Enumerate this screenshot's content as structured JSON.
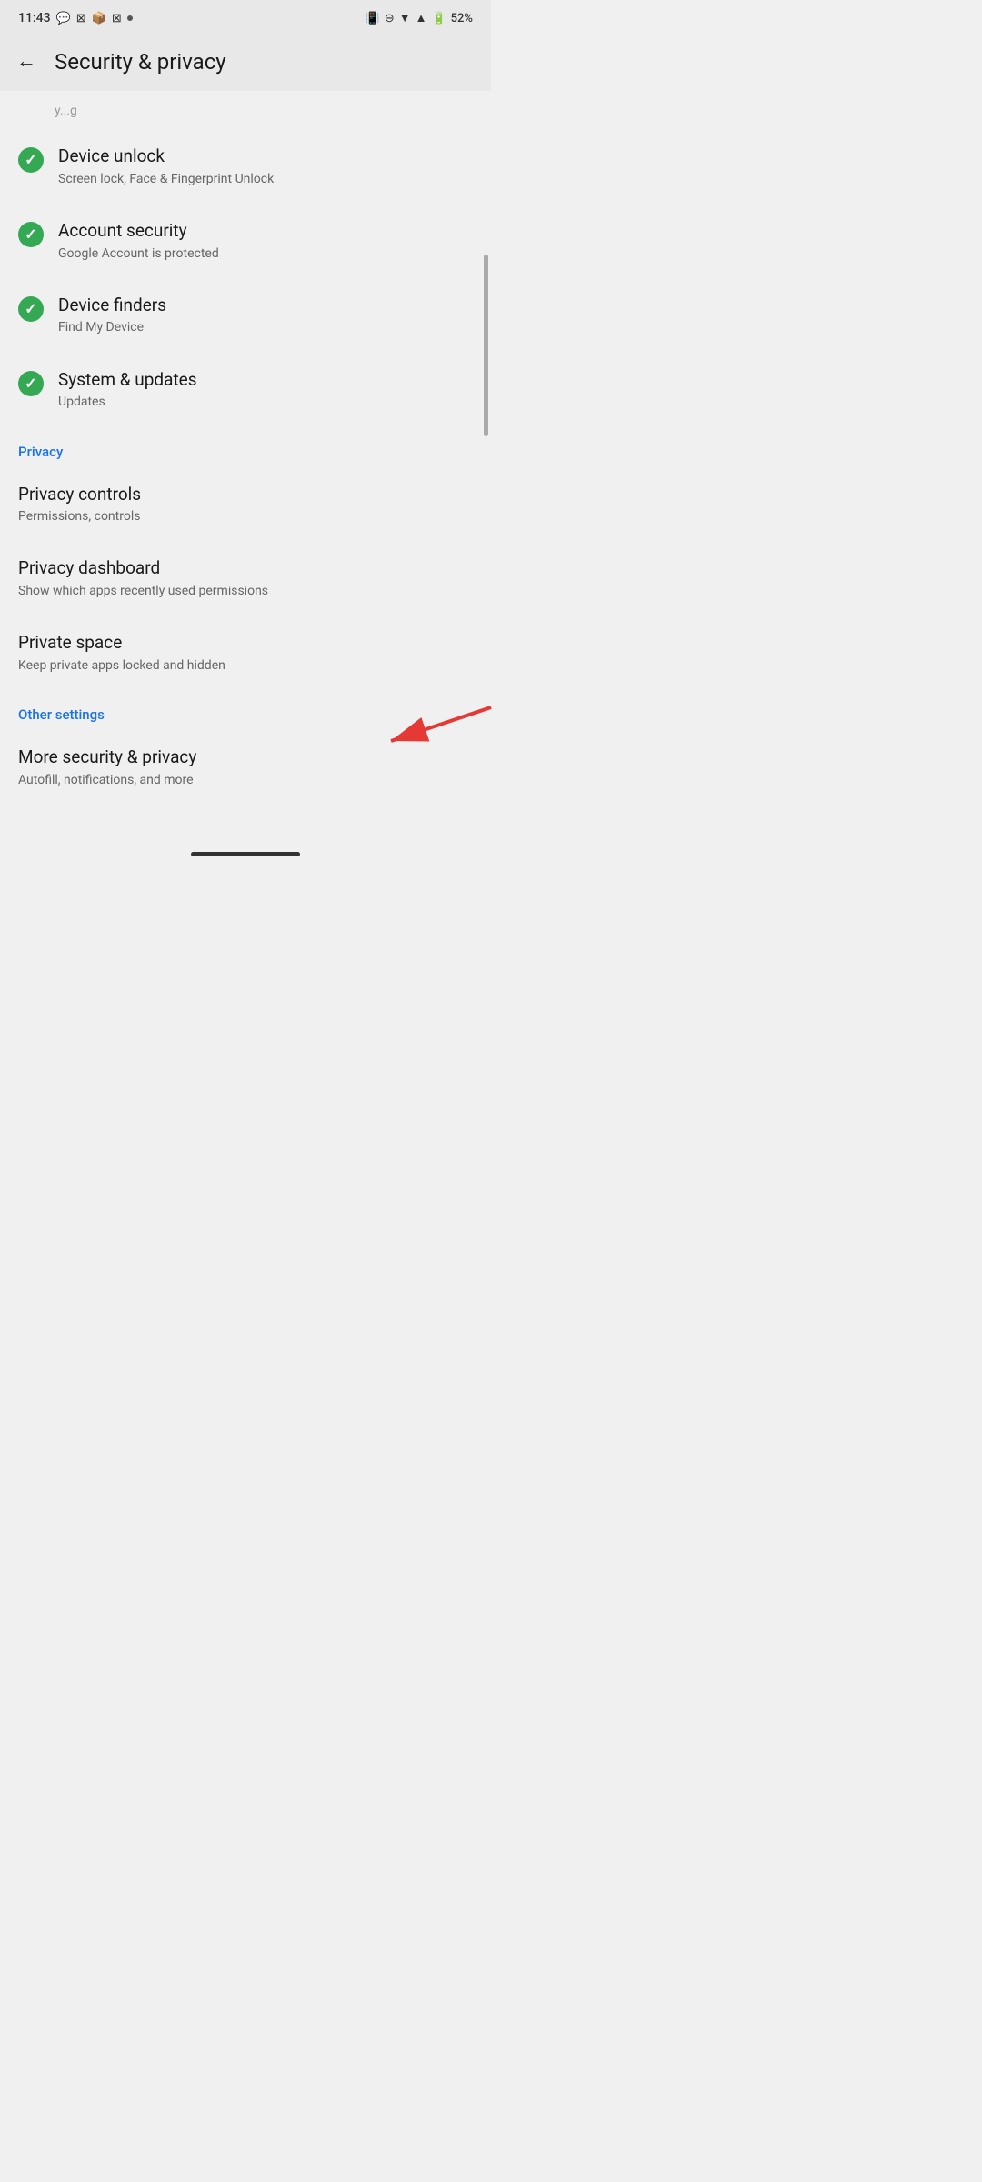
{
  "statusBar": {
    "time": "11:43",
    "battery": "52%",
    "icons": [
      "signal",
      "wifi",
      "battery"
    ]
  },
  "header": {
    "title": "Security & privacy",
    "backLabel": "←"
  },
  "partialItem": {
    "text": "y...g"
  },
  "securityItems": [
    {
      "title": "Device unlock",
      "subtitle": "Screen lock, Face & Fingerprint Unlock",
      "checked": true
    },
    {
      "title": "Account security",
      "subtitle": "Google Account is protected",
      "checked": true
    },
    {
      "title": "Device finders",
      "subtitle": "Find My Device",
      "checked": true
    },
    {
      "title": "System & updates",
      "subtitle": "Updates",
      "checked": true
    }
  ],
  "privacySection": {
    "label": "Privacy",
    "items": [
      {
        "title": "Privacy controls",
        "subtitle": "Permissions, controls"
      },
      {
        "title": "Privacy dashboard",
        "subtitle": "Show which apps recently used permissions"
      },
      {
        "title": "Private space",
        "subtitle": "Keep private apps locked and hidden"
      }
    ]
  },
  "otherSection": {
    "label": "Other settings",
    "items": [
      {
        "title": "More security & privacy",
        "subtitle": "Autofill, notifications, and more",
        "hasArrow": true
      }
    ]
  }
}
